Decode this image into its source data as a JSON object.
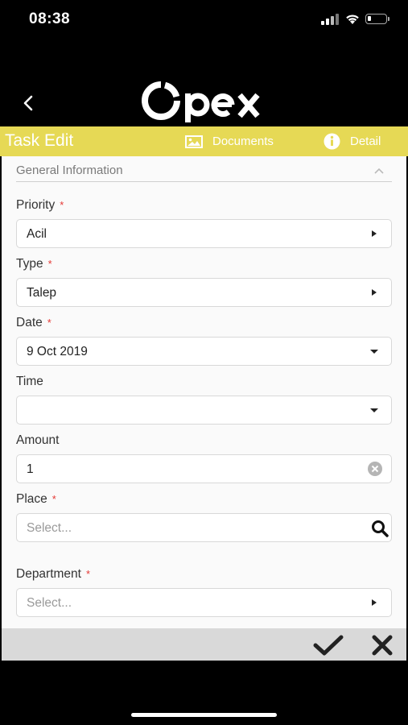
{
  "status_bar": {
    "time": "08:38"
  },
  "brand": {
    "logo_text": "Opex"
  },
  "header": {
    "title": "Task Edit",
    "tabs": [
      {
        "label": "Documents",
        "icon": "image-icon"
      },
      {
        "label": "Detail",
        "icon": "info-icon"
      }
    ]
  },
  "section": {
    "title": "General Information"
  },
  "form": {
    "priority": {
      "label": "Priority",
      "required": "*",
      "value": "Acil"
    },
    "type": {
      "label": "Type",
      "required": "*",
      "value": "Talep"
    },
    "date": {
      "label": "Date",
      "required": "*",
      "value": "9 Oct 2019"
    },
    "time": {
      "label": "Time",
      "value": ""
    },
    "amount": {
      "label": "Amount",
      "value": "1"
    },
    "place": {
      "label": "Place",
      "required": "*",
      "placeholder": "Select..."
    },
    "department": {
      "label": "Department",
      "required": "*",
      "placeholder": "Select..."
    }
  },
  "colors": {
    "accent": "#e6d955",
    "required": "#e53935",
    "background": "#000000"
  }
}
